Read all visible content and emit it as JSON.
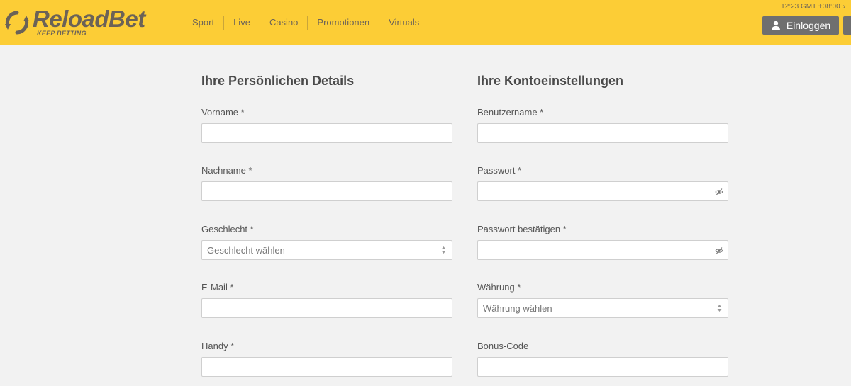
{
  "header": {
    "brand": "ReloadBet",
    "tagline": "KEEP BETTING",
    "nav": [
      "Sport",
      "Live",
      "Casino",
      "Promotionen",
      "Virtuals"
    ],
    "clock": "12:23 GMT +08:00",
    "login_label": "Einloggen",
    "colors": {
      "bar": "#fccd36",
      "button": "#6f6f6f"
    }
  },
  "personal": {
    "title": "Ihre Persönlichen Details",
    "first_name_label": "Vorname *",
    "last_name_label": "Nachname *",
    "gender_label": "Geschlecht *",
    "gender_placeholder": "Geschlecht wählen",
    "email_label": "E-Mail *",
    "phone_label": "Handy *"
  },
  "account": {
    "title": "Ihre Kontoeinstellungen",
    "username_label": "Benutzername *",
    "password_label": "Passwort *",
    "password_confirm_label": "Passwort bestätigen *",
    "currency_label": "Währung *",
    "currency_placeholder": "Währung wählen",
    "bonus_label": "Bonus-Code"
  }
}
